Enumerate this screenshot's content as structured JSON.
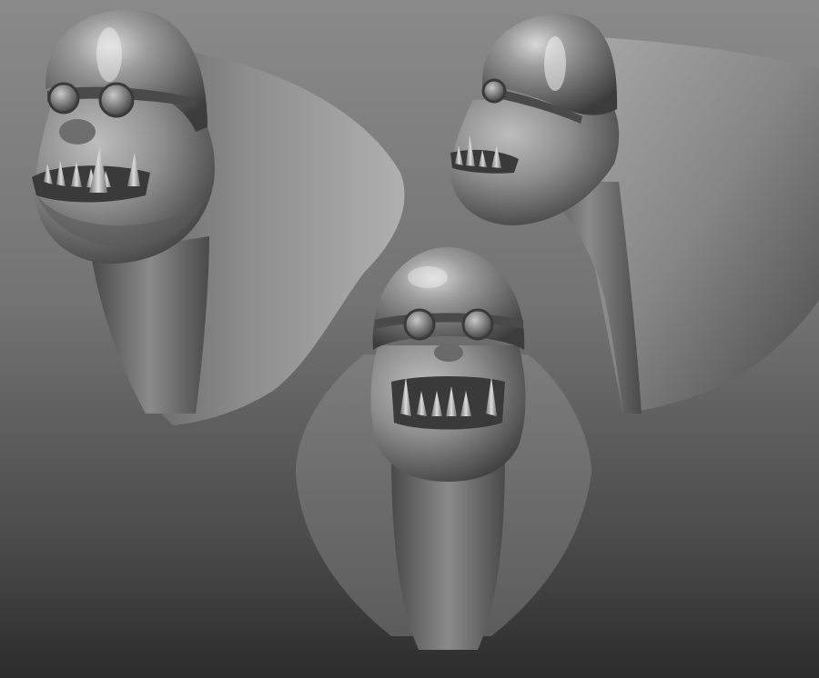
{
  "scene": {
    "subject": "orc-bust-sculpt-renders",
    "views": [
      {
        "id": "three-quarter",
        "part": "left-bust"
      },
      {
        "id": "profile",
        "part": "right-bust"
      },
      {
        "id": "front",
        "part": "center-bust"
      }
    ],
    "palette": {
      "bg_top": "#8c8c8c",
      "bg_mid": "#6e6e6e",
      "bg_bottom": "#2f2f2f",
      "clay_light": "#b4b4b4",
      "clay_mid": "#7a7a7a",
      "clay_dark": "#2e2e2e",
      "highlight": "#f2f2f2"
    }
  }
}
